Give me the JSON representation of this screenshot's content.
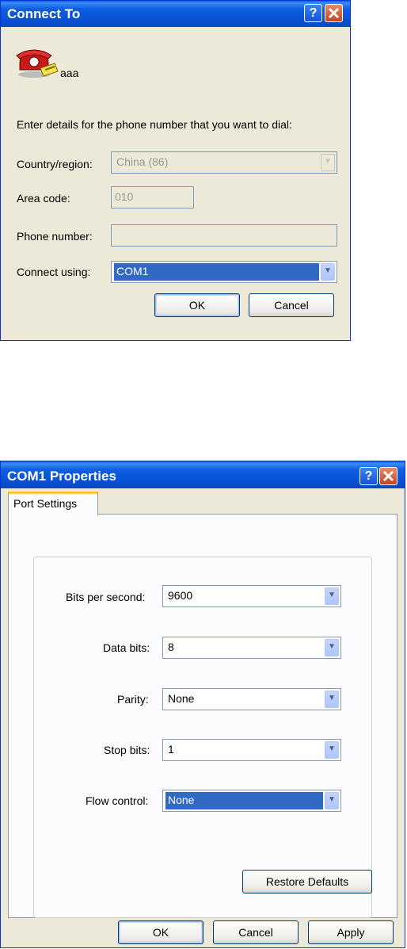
{
  "connect_dialog": {
    "title": "Connect To",
    "connection_name": "aaa",
    "instruction": "Enter details for the phone number that you want to dial:",
    "country_label": "Country/region:",
    "country_value": "China (86)",
    "area_code_label": "Area code:",
    "area_code_value": "010",
    "phone_label": "Phone number:",
    "phone_value": "",
    "connect_using_label": "Connect using:",
    "connect_using_value": "COM1",
    "ok_label": "OK",
    "cancel_label": "Cancel"
  },
  "com_dialog": {
    "title": "COM1 Properties",
    "tab_label": "Port Settings",
    "bits_label": "Bits per second:",
    "bits_value": "9600",
    "data_bits_label": "Data bits:",
    "data_bits_value": "8",
    "parity_label": "Parity:",
    "parity_value": "None",
    "stop_bits_label": "Stop bits:",
    "stop_bits_value": "1",
    "flow_label": "Flow control:",
    "flow_value": "None",
    "restore_label": "Restore Defaults",
    "ok_label": "OK",
    "cancel_label": "Cancel",
    "apply_label": "Apply"
  },
  "titlebar_buttons": {
    "help_glyph": "?",
    "close_glyph": "✕"
  },
  "icons": [
    "phone-icon",
    "help-icon",
    "close-icon",
    "dropdown-arrow-icon"
  ],
  "colors": {
    "title_bar": "#0a5fe6",
    "dialog_bg": "#ece9d8",
    "selection": "#316ac5",
    "tab_accent": "#ffc83c"
  }
}
